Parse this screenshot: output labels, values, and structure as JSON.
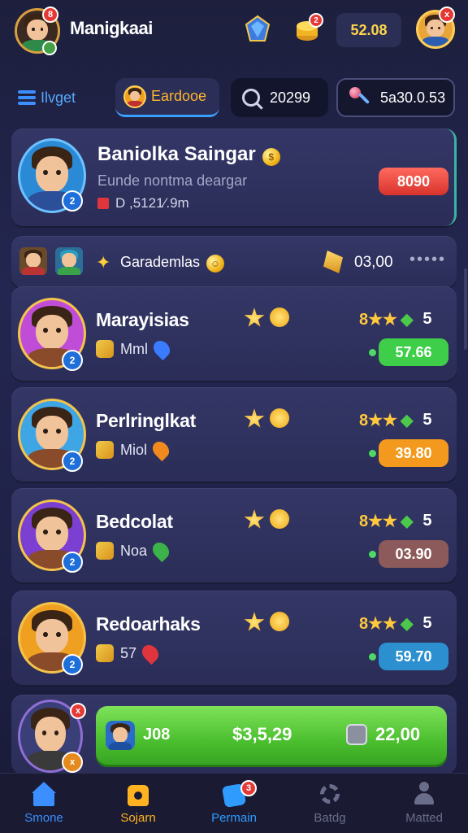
{
  "header": {
    "player_name": "Manigkaai",
    "avatar_badge": "8",
    "notification_badge": "2",
    "balance": "52.08",
    "profile_badge": "x"
  },
  "tabs": [
    {
      "label": "Ilvget",
      "icon": "menu-icon"
    },
    {
      "label": "Eardooe",
      "icon": "avatar-icon"
    },
    {
      "label": "20299",
      "icon": "search-icon"
    },
    {
      "label": "5a30.0.53",
      "icon": "wand-icon"
    }
  ],
  "featured": {
    "name": "Baniolka Saingar",
    "subtitle": "Eunde nontma deargar",
    "stat": "D ,5121⁄.9m",
    "price": "8090",
    "badge": "2"
  },
  "strip": {
    "label": "Garademlas",
    "value": "03,00",
    "more": "•••••"
  },
  "players": [
    {
      "name": "Marayisias",
      "info": "Mml",
      "rank": "8★★",
      "level": "5",
      "bet": "57.66",
      "bet_color": "#3fce4a",
      "pin_color": "#3a7bff",
      "frame": "#c04dd8"
    },
    {
      "name": "Perlringlkat",
      "info": "Miol",
      "rank": "8★★",
      "level": "5",
      "bet": "39.80",
      "bet_color": "#f39a1e",
      "pin_color": "#f08a1e",
      "frame": "#3fa6e6"
    },
    {
      "name": "Bedcolat",
      "info": "Noa",
      "rank": "8★★",
      "level": "5",
      "bet": "03.90",
      "bet_color": "#8c5a5a",
      "pin_color": "#3bb24a",
      "frame": "#7b3fd1"
    },
    {
      "name": "Redoarhaks",
      "info": "57",
      "rank": "8★★",
      "level": "5",
      "bet": "59.70",
      "bet_color": "#2b8fd0",
      "pin_color": "#e0353c",
      "frame": "#f0a020"
    }
  ],
  "cta": {
    "job": "J08",
    "total": "$3,5,29",
    "amount": "22,00"
  },
  "nav": [
    {
      "label": "Smone",
      "icon": "home-icon",
      "color": "#3b8fff"
    },
    {
      "label": "Sojarn",
      "icon": "shop-icon",
      "color": "#ffb321"
    },
    {
      "label": "Permain",
      "icon": "play-icon",
      "color": "#2f9bff",
      "badge": "3"
    },
    {
      "label": "Batdg",
      "icon": "gear-icon",
      "color": "#6a6d8a"
    },
    {
      "label": "Matted",
      "icon": "profile-icon",
      "color": "#6a6d8a"
    }
  ]
}
